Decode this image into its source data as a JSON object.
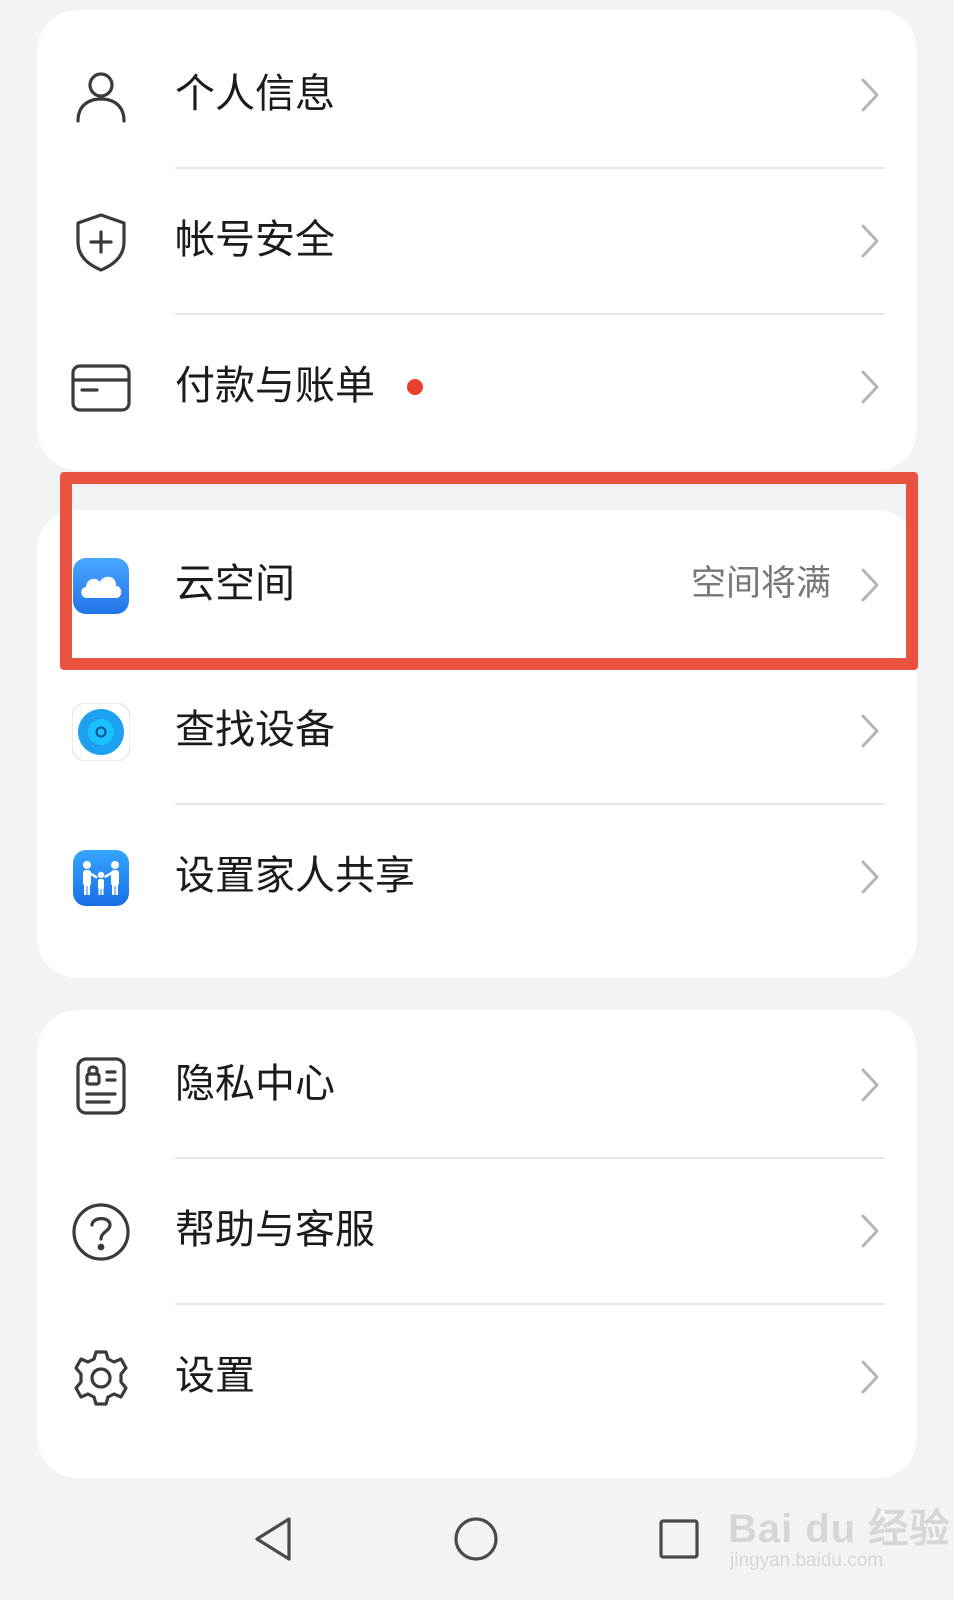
{
  "groups": [
    {
      "items": [
        {
          "label": "个人信息",
          "icon": "person-icon"
        },
        {
          "label": "帐号安全",
          "icon": "shield-plus-icon"
        },
        {
          "label": "付款与账单",
          "icon": "card-icon",
          "badge": "red-dot"
        }
      ]
    },
    {
      "items": [
        {
          "label": "云空间",
          "icon": "cloud-app-icon",
          "value": "空间将满"
        },
        {
          "label": "查找设备",
          "icon": "find-device-app-icon"
        },
        {
          "label": "设置家人共享",
          "icon": "family-share-app-icon"
        }
      ]
    },
    {
      "items": [
        {
          "label": "隐私中心",
          "icon": "privacy-icon"
        },
        {
          "label": "帮助与客服",
          "icon": "help-icon"
        },
        {
          "label": "设置",
          "icon": "gear-icon"
        }
      ]
    }
  ],
  "colors": {
    "background": "#f1f3f5",
    "card": "#ffffff",
    "badge_dot": "#e8402e",
    "highlight_frame": "#e8523e",
    "cloud_app": "#2f8cf0",
    "find_device_app": "#1ea0f0",
    "family_app": "#1f7cf2"
  },
  "navbar": {
    "back_icon": "triangle-back-icon",
    "home_icon": "circle-home-icon",
    "recent_icon": "square-recent-icon"
  },
  "watermark": {
    "main": "Bai du 经验",
    "sub": "jingyan.baidu.com"
  }
}
